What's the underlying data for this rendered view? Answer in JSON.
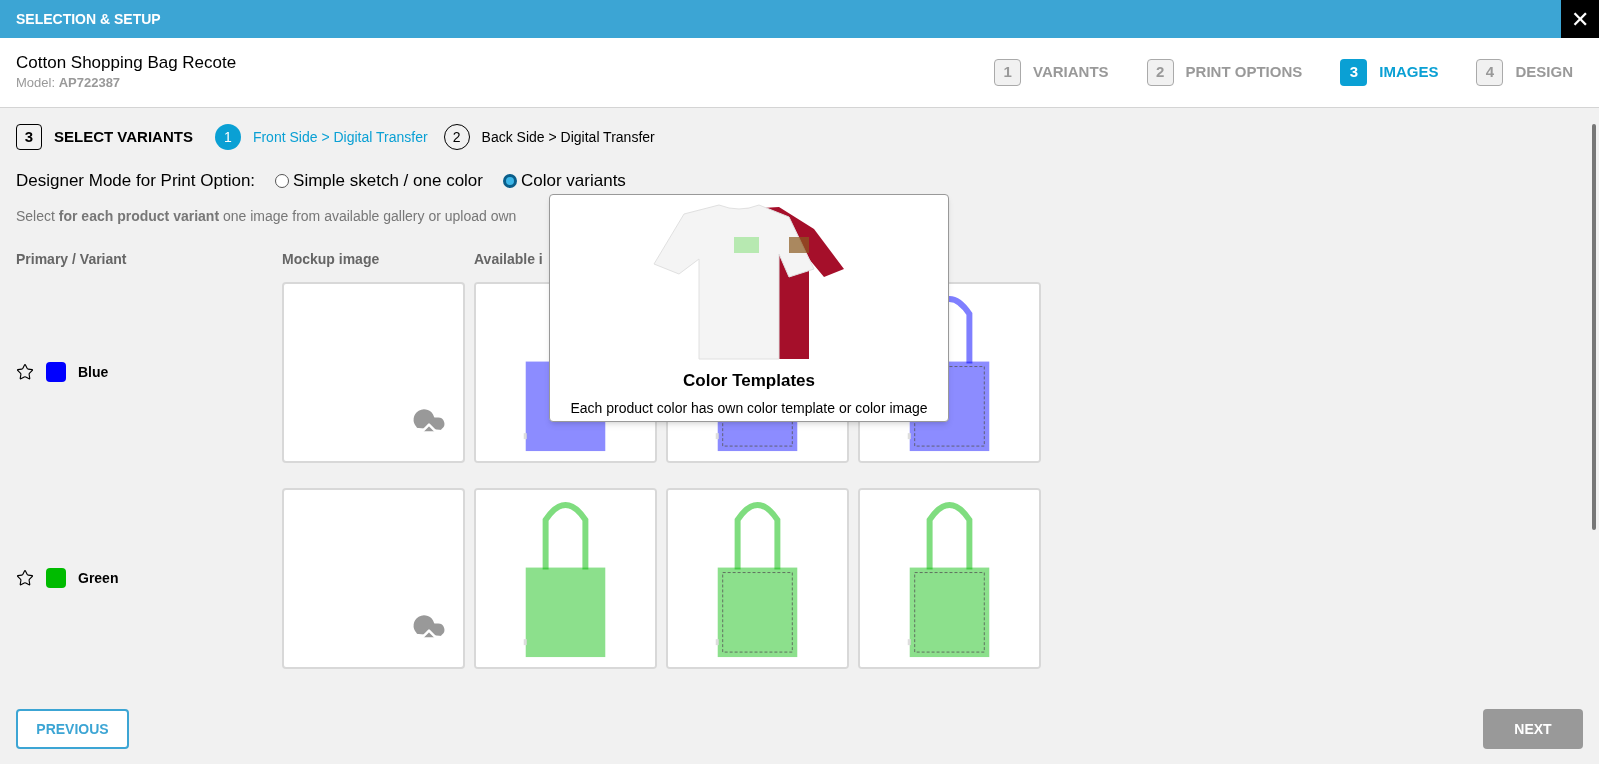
{
  "window": {
    "title": "SELECTION & SETUP",
    "close": "✕"
  },
  "product": {
    "name": "Cotton Shopping Bag Recote",
    "model_label": "Model:",
    "model": "AP722387"
  },
  "steps": [
    {
      "number": "1",
      "label": "VARIANTS",
      "selected": false
    },
    {
      "number": "2",
      "label": "PRINT OPTIONS",
      "selected": false
    },
    {
      "number": "3",
      "label": "IMAGES",
      "selected": true
    },
    {
      "number": "4",
      "label": "DESIGN",
      "selected": false
    }
  ],
  "section": {
    "number": "3",
    "title": "SELECT VARIANTS"
  },
  "print_sides": [
    {
      "number": "1",
      "label": "Front Side > Digital Transfer",
      "selected": true
    },
    {
      "number": "2",
      "label": "Back Side > Digital Transfer",
      "selected": false
    }
  ],
  "designer_mode": {
    "label": "Designer Mode for Print Option:",
    "options": [
      {
        "label": "Simple sketch / one color",
        "selected": false
      },
      {
        "label": "Color variants",
        "selected": true
      }
    ]
  },
  "instruction": "Select **for each product variant** one image from available gallery or upload own",
  "columns": [
    "Primary / Variant",
    "Mockup image",
    "Available i"
  ],
  "variants": [
    {
      "name": "Blue",
      "color": "#0000ff",
      "primary": false
    },
    {
      "name": "Green",
      "color": "#00bb00",
      "primary": false
    }
  ],
  "tooltip": {
    "title": "Color Templates",
    "text": "Each product color has own color template or color image"
  },
  "buttons": {
    "previous": "PREVIOUS",
    "next": "NEXT"
  }
}
